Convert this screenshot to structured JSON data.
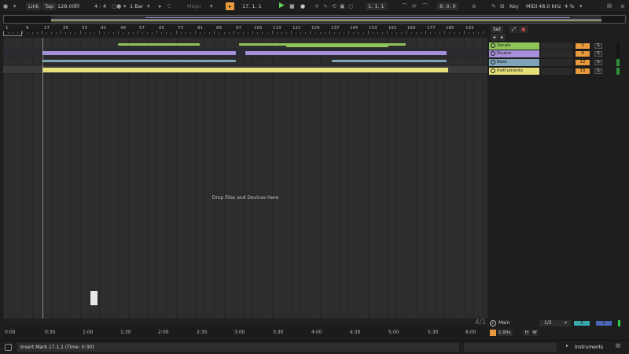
{
  "transport": {
    "link_label": "Link",
    "tap_label": "Tap",
    "tempo": "128.00",
    "time_sig_num": "4",
    "time_sig_den": "4",
    "quantize": "1 Bar",
    "key": "C",
    "scale": "Major",
    "position": "17.   1.   1",
    "loop_start": "1.   1.   1",
    "loop_length": "8.   0.   0",
    "key_label": "Key",
    "midi_label": "MIDI",
    "sample_rate": "48.0 kHz",
    "cpu": "4 %"
  },
  "ruler": {
    "bar_numbers": [
      "1",
      "9",
      "17",
      "25",
      "33",
      "41",
      "49",
      "57",
      "65",
      "73",
      "81",
      "89",
      "97",
      "105",
      "113",
      "121",
      "129",
      "137",
      "145",
      "153",
      "161",
      "169",
      "177",
      "185",
      "193"
    ]
  },
  "arrangement": {
    "drop_text": "Drop Files and Devices Here"
  },
  "timeline": {
    "labels": [
      "0:00",
      "0:30",
      "1:00",
      "1:30",
      "2:00",
      "2:30",
      "3:00",
      "3:30",
      "4:00",
      "4:30",
      "5:00",
      "5:30",
      "6:00"
    ]
  },
  "mixer": {
    "set_label": "Set",
    "tracks": [
      {
        "name": "Vocals",
        "number": "3",
        "solo": "S",
        "color": "#8fc45a"
      },
      {
        "name": "Drums",
        "number": "4",
        "solo": "S",
        "color": "#a48fd8"
      },
      {
        "name": "Bass",
        "number": "12",
        "solo": "S",
        "color": "#7fa4b8"
      },
      {
        "name": "Instruments",
        "number": "15",
        "solo": "S",
        "color": "#e6e07a"
      }
    ],
    "main": {
      "name": "Main",
      "routing": "1/2",
      "vol_a": "0",
      "vol_b": "0",
      "zoom": "1.00x",
      "h_label": "H",
      "w_label": "W",
      "beat_readout": "4/1"
    }
  },
  "status": {
    "message": "Insert Mark 17.1.1 (Time: 0:30)",
    "target": "Instruments"
  },
  "colors": {
    "vocals": "#8fc45a",
    "drums": "#a48fd8",
    "bass": "#7fa4b8",
    "instruments": "#e6e07a",
    "accent": "#e89a3c"
  }
}
